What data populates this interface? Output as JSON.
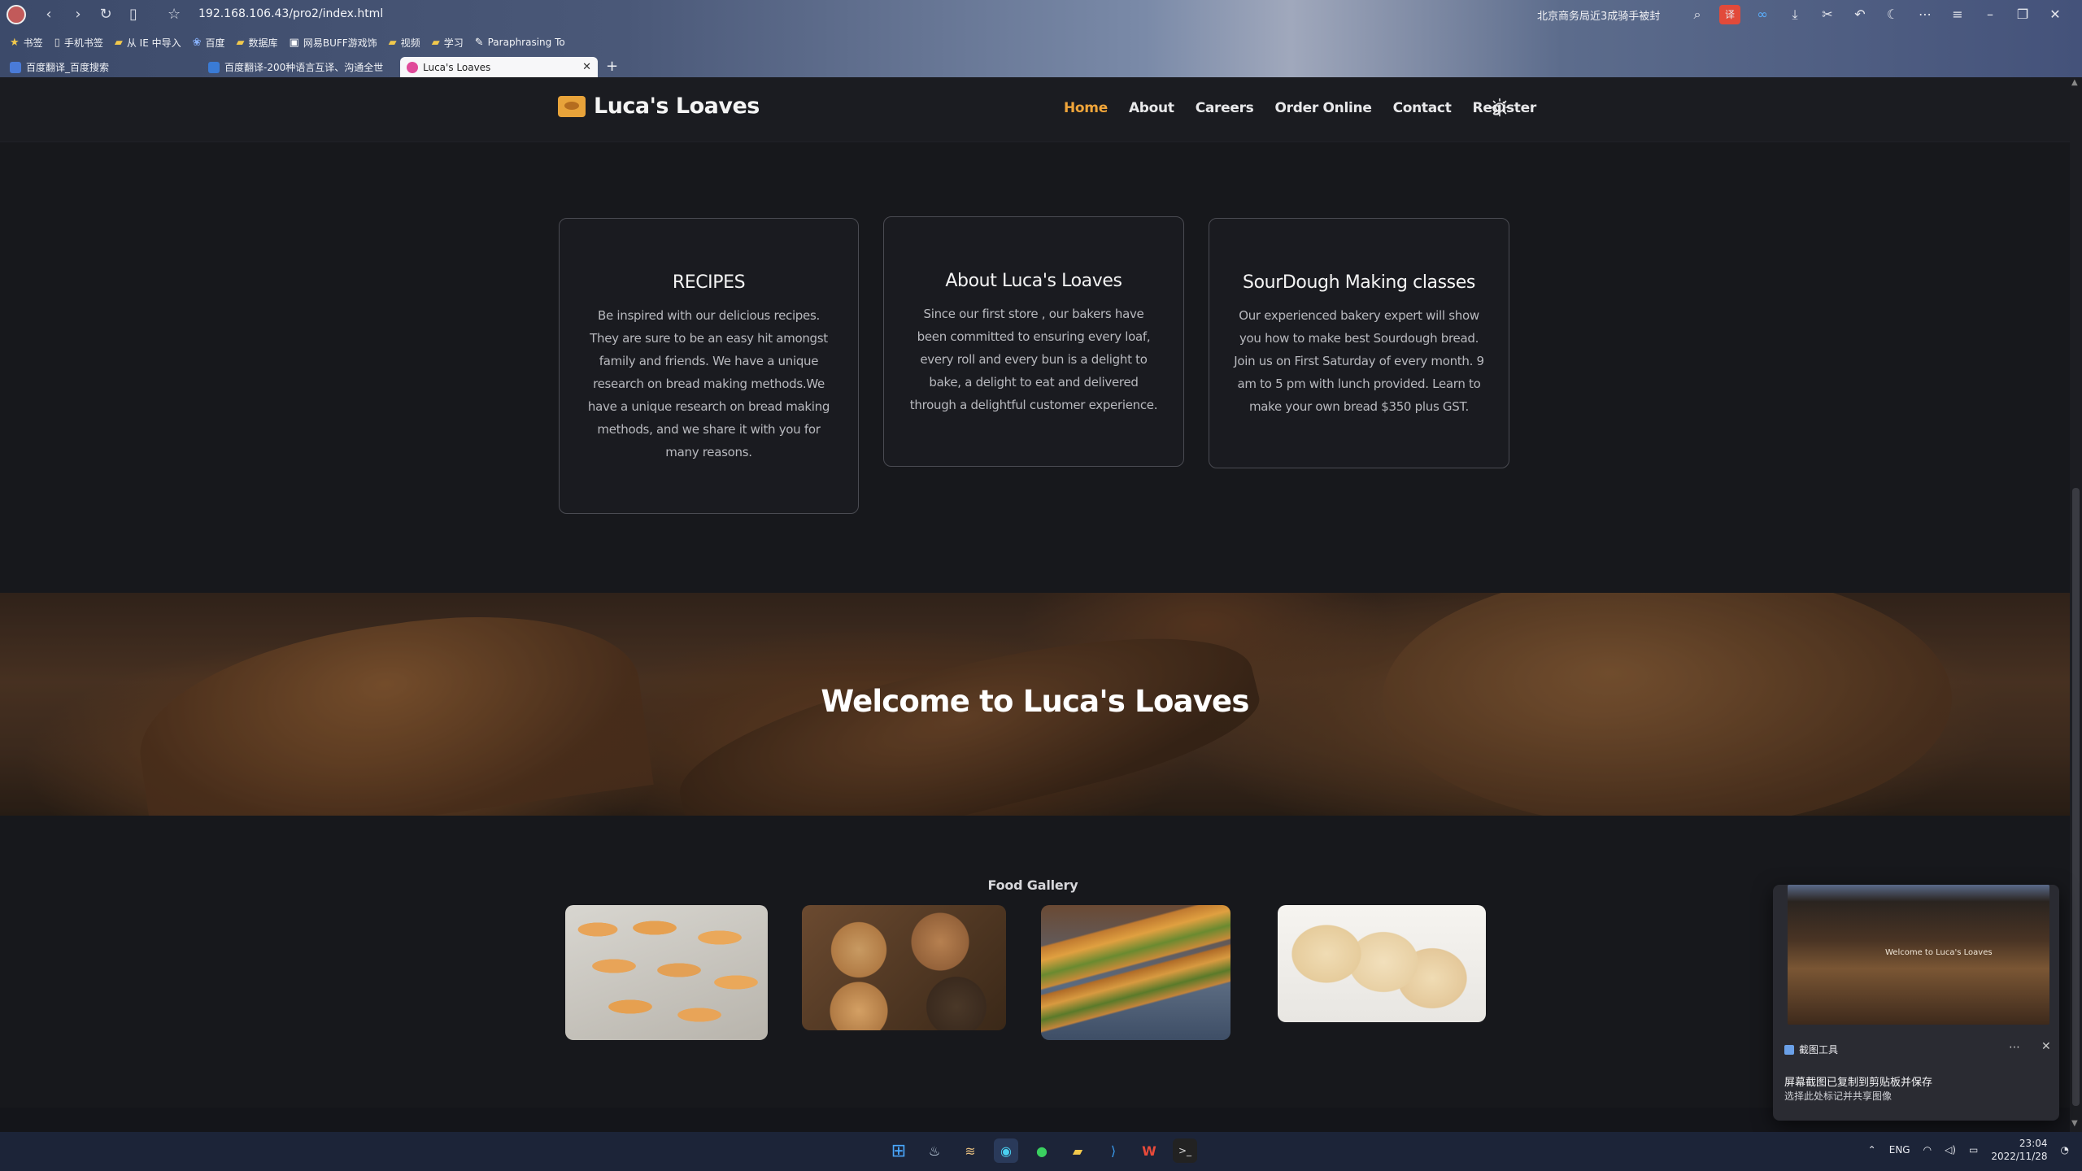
{
  "browser": {
    "url": "192.168.106.43/pro2/index.html",
    "news_text": "北京商务局近3成骑手被封",
    "bookmarks": [
      {
        "label": "书签",
        "icon": "star-icon"
      },
      {
        "label": "手机书签",
        "icon": "phone-icon"
      },
      {
        "label": "从 IE 中导入",
        "icon": "folder-icon"
      },
      {
        "label": "百度",
        "icon": "baidu-icon"
      },
      {
        "label": "数据库",
        "icon": "folder-icon"
      },
      {
        "label": "网易BUFF游戏饰",
        "icon": "buff-icon"
      },
      {
        "label": "视频",
        "icon": "folder-icon"
      },
      {
        "label": "学习",
        "icon": "folder-icon"
      },
      {
        "label": "Paraphrasing To",
        "icon": "pen-icon"
      }
    ],
    "tabs": [
      {
        "label": "百度翻译_百度搜索",
        "active": false
      },
      {
        "label": "百度翻译-200种语言互译、沟通全世",
        "active": false
      },
      {
        "label": "Luca's Loaves",
        "active": true
      }
    ]
  },
  "site": {
    "brand": "Luca's Loaves",
    "nav": [
      {
        "label": "Home",
        "active": true
      },
      {
        "label": "About",
        "active": false
      },
      {
        "label": "Careers",
        "active": false
      },
      {
        "label": "Order Online",
        "active": false
      },
      {
        "label": "Contact",
        "active": false
      },
      {
        "label": "Register",
        "active": false
      }
    ],
    "accent_color": "#f0a53a",
    "cards": [
      {
        "title": "RECIPES",
        "text": "Be inspired with our delicious recipes. They are sure to be an easy hit amongst family and friends. We have a unique research on bread making methods.We have a unique research on bread making methods, and we share it with you for many reasons."
      },
      {
        "title": "About Luca's Loaves",
        "text": "Since our first store , our bakers have been committed to ensuring every loaf, every roll and every bun is a delight to bake, a delight to eat and delivered through a delightful customer experience."
      },
      {
        "title": "SourDough Making classes",
        "text": "Our experienced bakery expert will show you how to make best Sourdough bread. Join us on First Saturday of every month. 9 am to 5 pm with lunch provided. Learn to make your own bread $350 plus GST."
      }
    ],
    "hero_title": "Welcome to Luca's Loaves",
    "gallery_title": "Food Gallery"
  },
  "taskbar": {
    "lang": "ENG",
    "time": "23:04",
    "date": "2022/11/28"
  },
  "toast": {
    "app": "截图工具",
    "title": "屏幕截图已复制到剪贴板并保存",
    "body": "选择此处标记并共享图像",
    "thumb_text": "Welcome to Luca's Loaves"
  }
}
